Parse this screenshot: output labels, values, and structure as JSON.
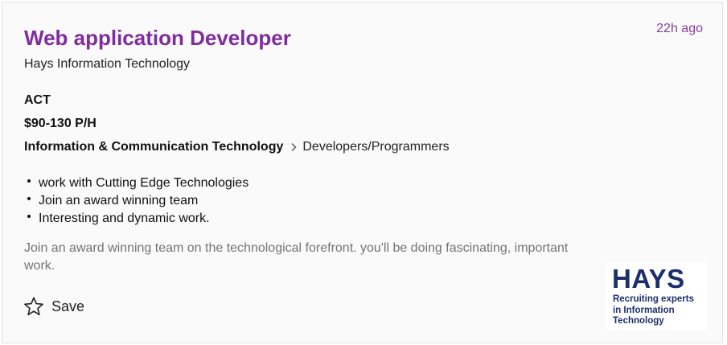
{
  "job": {
    "title": "Web application Developer",
    "posted": "22h ago",
    "company": "Hays Information Technology",
    "location": "ACT",
    "salary": "$90-130 P/H",
    "classification": "Information & Communication Technology",
    "subclassification": "Developers/Programmers",
    "bullets": [
      "work with Cutting Edge Technologies",
      "Join an award winning team",
      "Interesting and dynamic work."
    ],
    "teaser": "Join an award winning team on the technological forefront. you'll be doing fascinating, important work.",
    "save_label": "Save"
  },
  "logo": {
    "brand": "HAYS",
    "tagline": [
      "Recruiting experts",
      "in Information",
      "Technology"
    ],
    "color": "#1b2f6b"
  },
  "colors": {
    "title": "#7e2c9e",
    "timestamp": "#8a3e9f",
    "teaser": "#747474"
  },
  "icons": {
    "chevron": "chevron-right-icon",
    "save": "star-outline-icon"
  }
}
